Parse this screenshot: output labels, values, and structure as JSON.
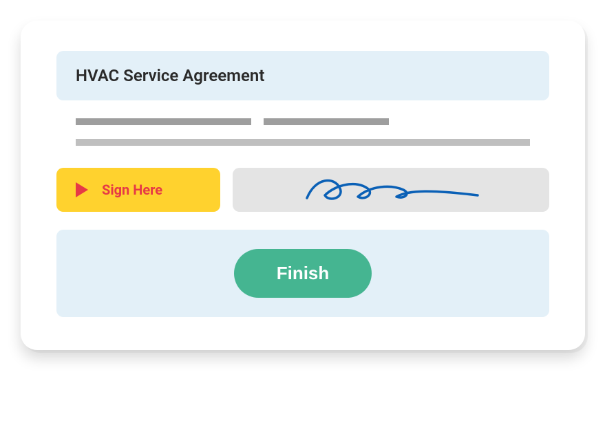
{
  "title": "HVAC Service Agreement",
  "actions": {
    "sign_label": "Sign Here",
    "finish_label": "Finish"
  },
  "colors": {
    "panel_bg": "#e3f0f8",
    "sign_bg": "#ffd22e",
    "sign_fg": "#e63946",
    "finish_bg": "#45b591",
    "signature_ink": "#0a60b6"
  }
}
